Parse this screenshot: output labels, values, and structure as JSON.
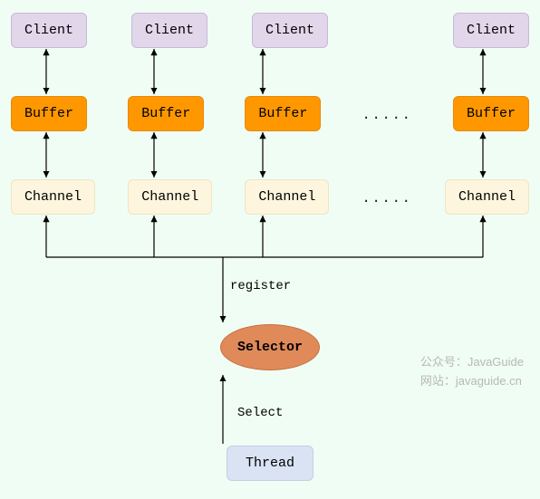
{
  "clients": [
    "Client",
    "Client",
    "Client",
    "Client"
  ],
  "buffers": [
    "Buffer",
    "Buffer",
    "Buffer",
    "Buffer"
  ],
  "channels": [
    "Channel",
    "Channel",
    "Channel",
    "Channel"
  ],
  "ellipsis": ".....",
  "selector": "Selector",
  "thread": "Thread",
  "labels": {
    "register": "register",
    "select": "Select"
  },
  "watermark": {
    "line1_label": "公众号：",
    "line1_value": "JavaGuide",
    "line2_label": "网站：",
    "line2_value": "javaguide.cn"
  }
}
